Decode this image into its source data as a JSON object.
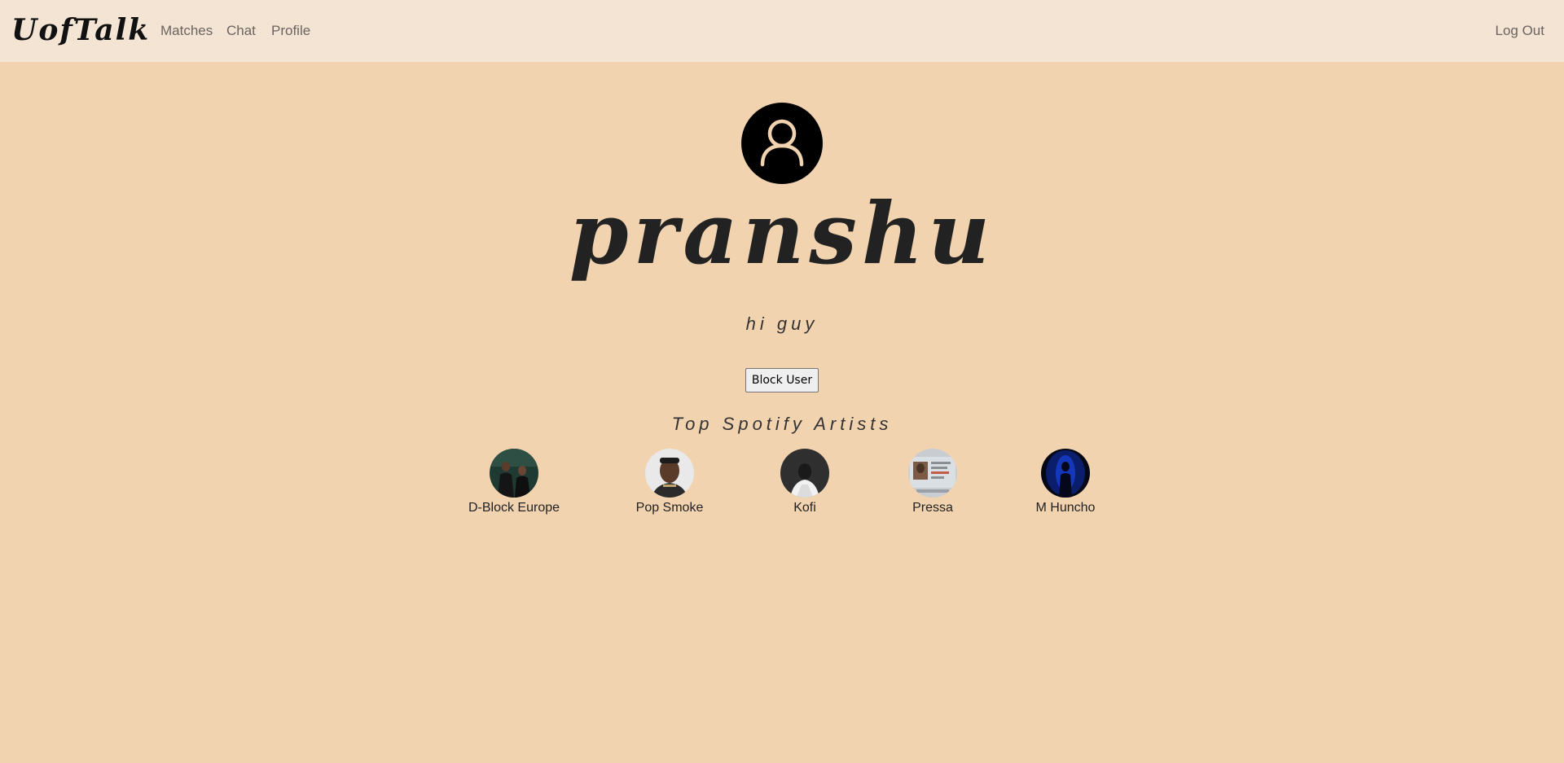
{
  "navbar": {
    "brand": "UofTalk",
    "links": [
      {
        "label": "Matches"
      },
      {
        "label": "Chat"
      },
      {
        "label": "Profile"
      }
    ],
    "logout_label": "Log Out"
  },
  "profile": {
    "avatar_icon": "user-icon",
    "username": "pranshu",
    "bio": "hi guy",
    "block_button_label": "Block User"
  },
  "spotify": {
    "section_title": "Top Spotify Artists",
    "artists": [
      {
        "name": "D-Block Europe"
      },
      {
        "name": "Pop Smoke"
      },
      {
        "name": "Kofi"
      },
      {
        "name": "Pressa"
      },
      {
        "name": "M Huncho"
      }
    ]
  },
  "colors": {
    "page_background": "#f2d3b0",
    "navbar_background": "#f3e4d4",
    "avatar_background": "#000000",
    "avatar_icon_stroke": "#f2d3b0"
  }
}
